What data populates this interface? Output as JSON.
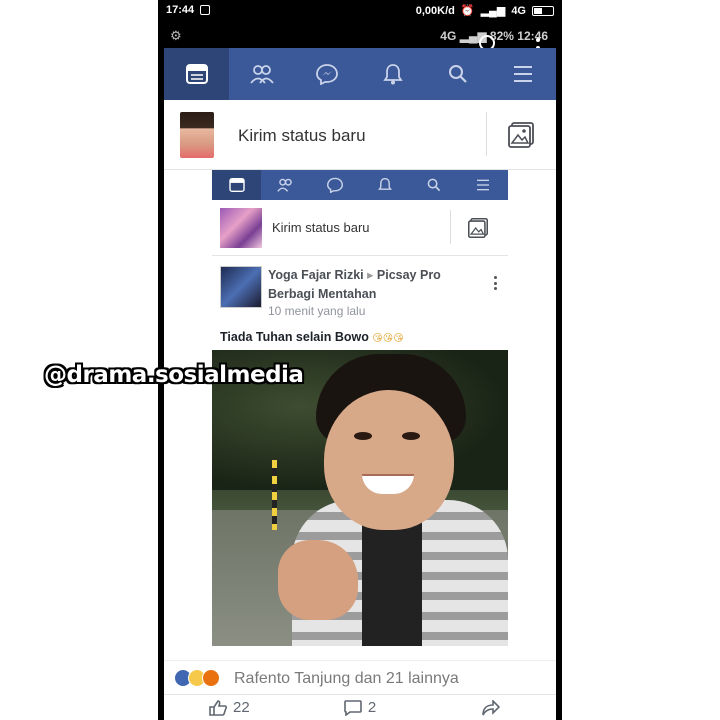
{
  "status_bar": {
    "time": "17:44",
    "network_speed": "0,00K/d",
    "network_type": "4G"
  },
  "status_bar_inner": {
    "indicators": "4G",
    "battery": "82%",
    "time": "12:46"
  },
  "navbar": {
    "tabs": [
      {
        "name": "news-feed",
        "icon": "news-feed-icon"
      },
      {
        "name": "friends",
        "icon": "friends-icon"
      },
      {
        "name": "messenger",
        "icon": "messenger-icon"
      },
      {
        "name": "notifications",
        "icon": "bell-icon"
      },
      {
        "name": "search",
        "icon": "search-icon"
      },
      {
        "name": "menu",
        "icon": "hamburger-menu-icon"
      }
    ]
  },
  "composer": {
    "placeholder": "Kirim status baru"
  },
  "nested_screenshot": {
    "composer": {
      "placeholder": "Kirim status baru"
    },
    "post": {
      "author": "Yoga Fajar Rizki",
      "arrow": "▸",
      "group": "Picsay Pro Berbagi Mentahan",
      "time": "10 menit yang lalu",
      "text": "Tiada Tuhan selain Bowo",
      "emoji": "😘😘😘"
    }
  },
  "reactions": {
    "summary": "Rafento Tanjung dan 21 lainnya"
  },
  "actions": {
    "like_count": "22",
    "comment_count": "2"
  },
  "watermark": "@drama.sosialmedia",
  "colors": {
    "facebook_blue": "#3b5998",
    "active_tab": "#2d4677"
  }
}
